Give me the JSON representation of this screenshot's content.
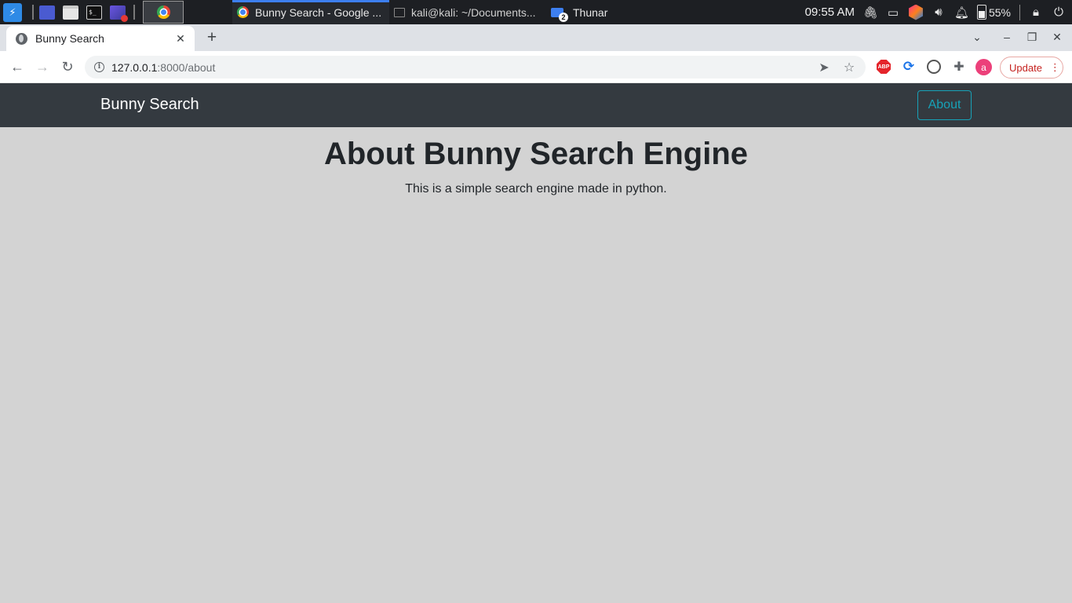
{
  "taskbar": {
    "windows": [
      {
        "label": "Bunny Search - Google ...",
        "active": true
      },
      {
        "label": "kali@kali: ~/Documents...",
        "active": false
      },
      {
        "label": "Thunar",
        "active": false
      }
    ],
    "clock": "09:55 AM",
    "battery": "55%",
    "icons": [
      "kali-menu-icon",
      "desktop-icon",
      "file-manager-icon",
      "terminal-icon",
      "screen-recorder-icon",
      "chrome-icon",
      "attachment-icon",
      "display-icon",
      "jetbrains-icon",
      "volume-icon",
      "bell-icon",
      "battery-icon",
      "lock-icon",
      "logout-icon"
    ]
  },
  "browser": {
    "tab_title": "Bunny Search",
    "url_host": "127.0.0.1",
    "url_rest": ":8000/about",
    "avatar_letter": "a",
    "extensions": {
      "abp": "ABP"
    },
    "update_label": "Update"
  },
  "site": {
    "brand": "Bunny Search",
    "nav_about": "About",
    "heading": "About Bunny Search Engine",
    "description": "This is a simple search engine made in python.",
    "colors": {
      "navbar": "#343a40",
      "accent": "#17a2b8",
      "background": "#d3d3d3"
    }
  }
}
